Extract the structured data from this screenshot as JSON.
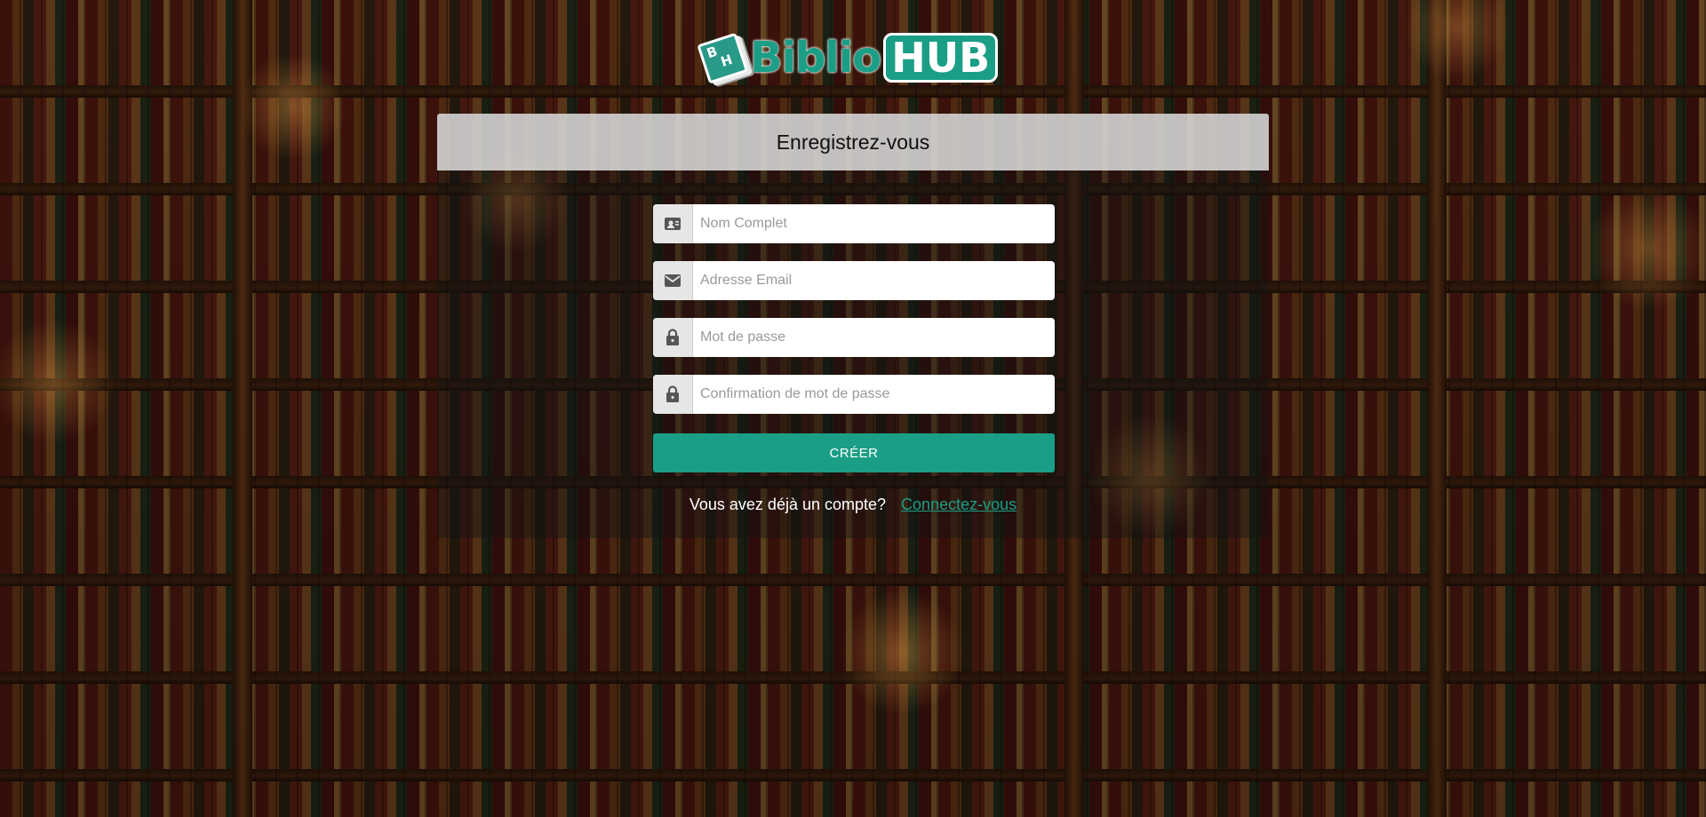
{
  "brand": {
    "logo_letters": [
      "B",
      "H"
    ],
    "name_part1": "Biblio",
    "name_part2": "HUB",
    "accent_color": "#1b9e86"
  },
  "form": {
    "title": "Enregistrez-vous",
    "fields": [
      {
        "icon": "contact-card-icon",
        "placeholder": "Nom Complet",
        "value": ""
      },
      {
        "icon": "envelope-icon",
        "placeholder": "Adresse Email",
        "value": ""
      },
      {
        "icon": "lock-icon",
        "placeholder": "Mot de passe",
        "value": ""
      },
      {
        "icon": "lock-icon",
        "placeholder": "Confirmation de mot de passe",
        "value": ""
      }
    ],
    "submit_label": "CRÉER",
    "login_prompt": "Vous avez déjà un compte?",
    "login_link": "Connectez-vous"
  }
}
